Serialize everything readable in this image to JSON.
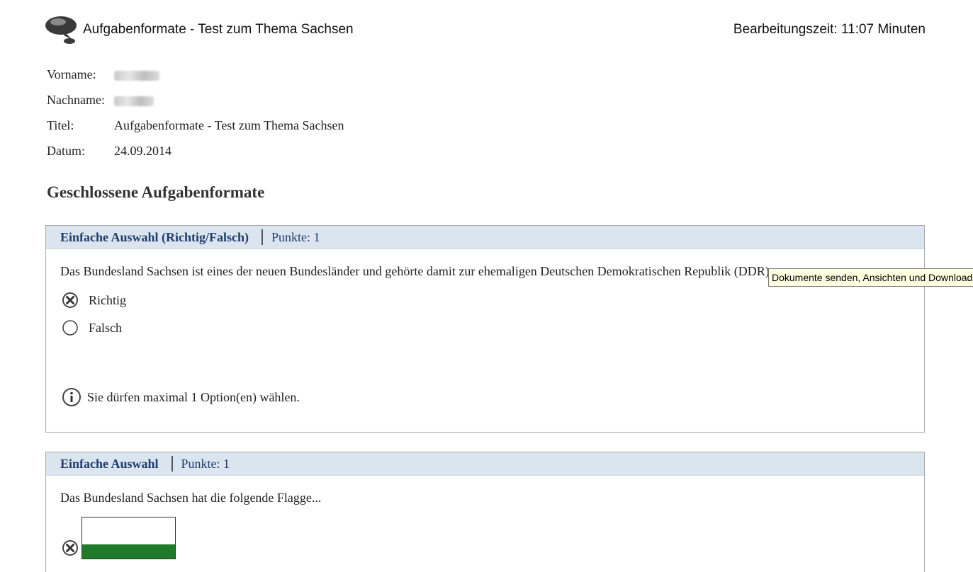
{
  "header": {
    "title": "Aufgabenformate - Test zum Thema Sachsen",
    "time": "Bearbeitungszeit: 11:07 Minuten",
    "logo_icon": "speech-bubble-logo-icon"
  },
  "meta": {
    "vorname_label": "Vorname:",
    "nachname_label": "Nachname:",
    "titel_label": "Titel:",
    "titel_value": "Aufgabenformate - Test zum Thema Sachsen",
    "datum_label": "Datum:",
    "datum_value": "24.09.2014"
  },
  "section_title": "Geschlossene Aufgabenformate",
  "questions": [
    {
      "type": "Einfache Auswahl (Richtig/Falsch)",
      "points": "Punkte: 1",
      "text": "Das Bundesland Sachsen ist eines der neuen Bundesländer und gehörte damit zur ehemaligen Deutschen Demokratischen Republik (DDR).",
      "options": [
        {
          "label": "Richtig",
          "selected": true
        },
        {
          "label": "Falsch",
          "selected": false
        }
      ],
      "hint": "Sie dürfen maximal 1 Option(en) wählen."
    },
    {
      "type": "Einfache Auswahl",
      "points": "Punkte: 1",
      "text": "Das Bundesland Sachsen hat die folgende Flagge...",
      "options": [
        {
          "label": "",
          "selected": true,
          "image": "flag-white-green"
        }
      ]
    }
  ],
  "tooltip": "Dokumente senden, Ansichten und Downloads",
  "colors": {
    "header_bg": "#dbe5ef",
    "header_text": "#1f3c6b",
    "tooltip_bg": "#ffffe1",
    "flag_green": "#1f7a2a"
  }
}
